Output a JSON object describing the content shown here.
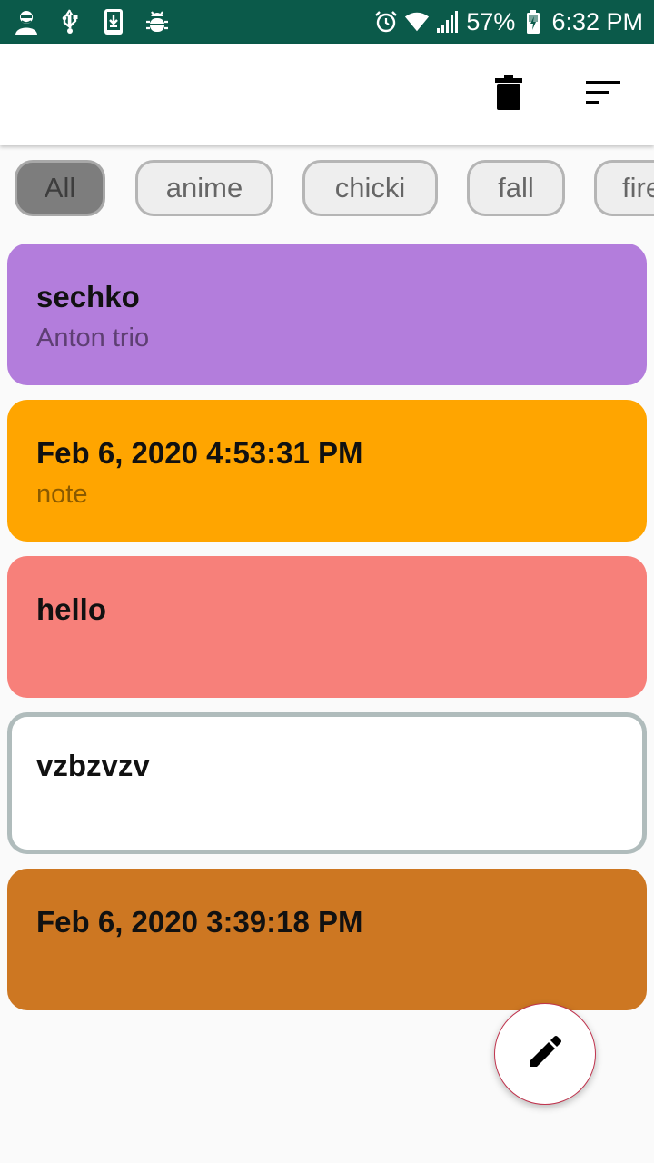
{
  "status_bar": {
    "battery": "57%",
    "time": "6:32 PM",
    "background": "#0b5a4a",
    "left_icons": [
      "app-avatar-icon",
      "usb-icon",
      "download-icon",
      "debug-bug-icon"
    ],
    "right_icons": [
      "alarm-icon",
      "wifi-icon",
      "signal-icon",
      "battery-charging-icon"
    ]
  },
  "toolbar": {
    "icons": [
      "trash-icon",
      "sort-icon"
    ]
  },
  "chips": [
    {
      "label": "All",
      "selected": true
    },
    {
      "label": "anime",
      "selected": false
    },
    {
      "label": "chicki",
      "selected": false
    },
    {
      "label": "fall",
      "selected": false
    },
    {
      "label": "fire",
      "selected": false
    }
  ],
  "notes": [
    {
      "title": "sechko",
      "subtitle": "Anton trio",
      "color": "#b37ddc",
      "subtitle_color": "#5e3f73"
    },
    {
      "title": "Feb 6, 2020 4:53:31 PM",
      "subtitle": "note",
      "color": "#ffa500",
      "subtitle_color": "#8a5a00"
    },
    {
      "title": "hello",
      "subtitle": "",
      "color": "#f7807a",
      "subtitle_color": "#7a3f3c"
    },
    {
      "title": "vzbzvzv",
      "subtitle": "",
      "color": "#ffffff",
      "border": "#b0bcbc",
      "subtitle_color": "#666666"
    },
    {
      "title": "Feb 6, 2020 3:39:18 PM",
      "subtitle": "",
      "color": "#cd7722",
      "subtitle_color": "#6a3d10"
    }
  ],
  "fab": {
    "icon": "pencil-edit-icon",
    "border": "#c0334d"
  }
}
